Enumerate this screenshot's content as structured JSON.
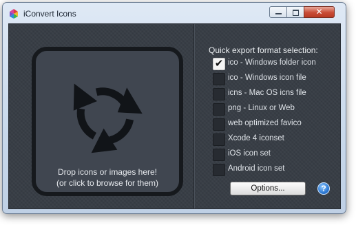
{
  "window": {
    "title": "iConvert Icons",
    "close_glyph": "✕"
  },
  "drop_zone": {
    "line1": "Drop icons or images here!",
    "line2": "(or click to browse for them)"
  },
  "formats": {
    "title": "Quick export format selection:",
    "items": [
      {
        "label": "ico - Windows folder icon",
        "checked": true
      },
      {
        "label": "ico - Windows icon file",
        "checked": false
      },
      {
        "label": "icns - Mac OS icns file",
        "checked": false
      },
      {
        "label": "png - Linux or Web",
        "checked": false
      },
      {
        "label": "web optimized favico",
        "checked": false
      },
      {
        "label": "Xcode 4 iconset",
        "checked": false
      },
      {
        "label": "iOS icon set",
        "checked": false
      },
      {
        "label": "Android icon set",
        "checked": false
      }
    ]
  },
  "options_button": {
    "label": "Options..."
  },
  "help": {
    "glyph": "?"
  },
  "icons": {
    "checkmark": "✔",
    "help": "help-icon",
    "app": "iconvert-app-icon",
    "drop": "refresh-cycle-icon"
  },
  "colors": {
    "panel": "#383e46",
    "drop_zone": "#404650",
    "drop_border": "#16191d",
    "text": "#e9ecef",
    "close_button": "#c94c37",
    "help_accent": "#2f7bd5"
  }
}
